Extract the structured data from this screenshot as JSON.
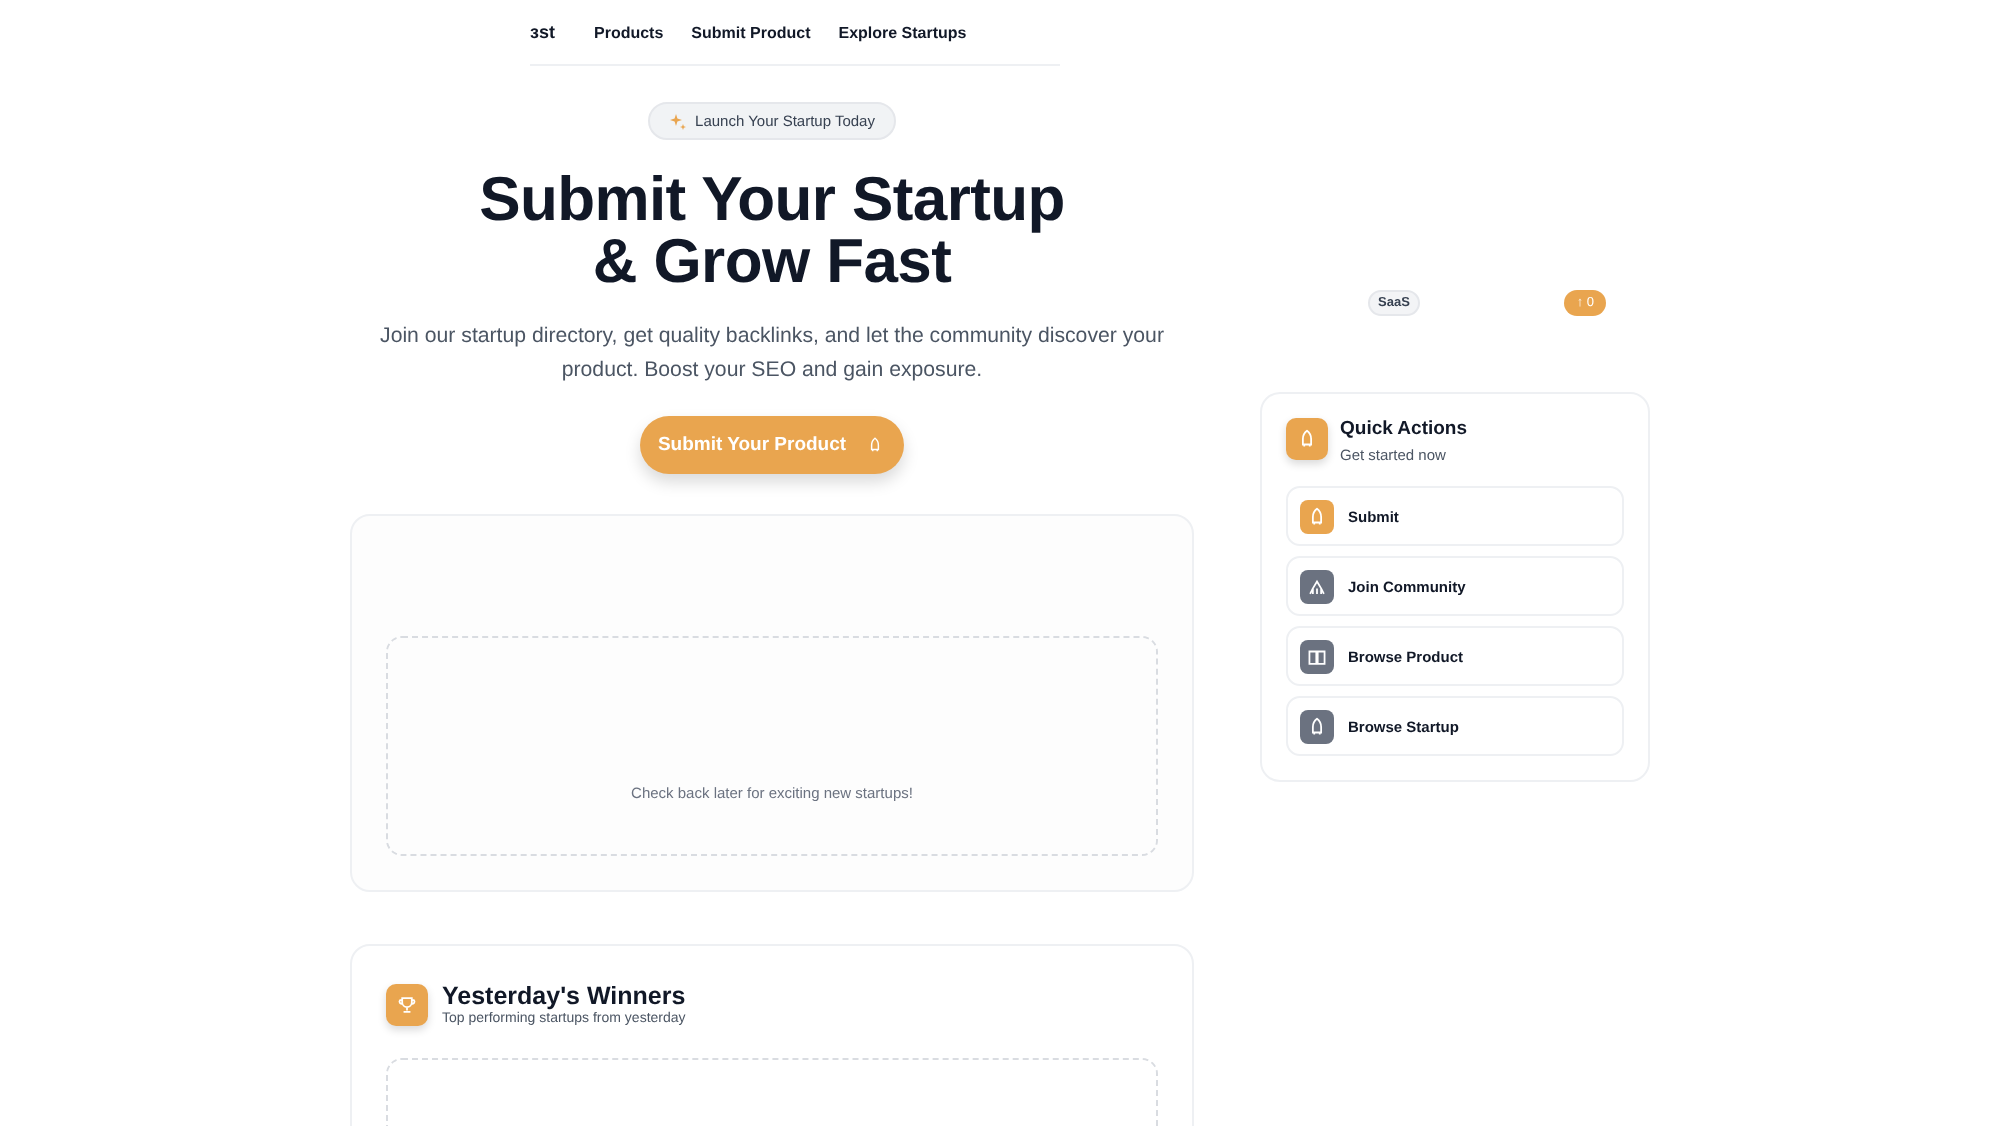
{
  "nav": {
    "logo": "ɜst",
    "links": [
      {
        "label": "Products"
      },
      {
        "label": "Submit Product"
      },
      {
        "label": "Explore Startups"
      }
    ]
  },
  "hero": {
    "badge": "Launch Your Startup Today",
    "title_lines": [
      "Submit Your Startup",
      "& Grow Fast"
    ],
    "subtitle": "Join our startup directory, get quality backlinks, and let the community discover your product. Boost your SEO and gain exposure.",
    "cta": "Submit Your Product"
  },
  "tag": "SaaS",
  "upvote": "↑ 0",
  "launches": {
    "empty_text": "Check back later for exciting new startups!"
  },
  "winners": {
    "title": "Yesterday's Winners",
    "subtitle": "Top performing startups from yesterday"
  },
  "quick_actions": {
    "title": "Quick Actions",
    "subtitle": "Get started now",
    "items": [
      {
        "label": "Submit",
        "kind": "primary"
      },
      {
        "label": "Join Community",
        "kind": "secondary"
      },
      {
        "label": "Browse Product",
        "kind": "secondary"
      },
      {
        "label": "Browse Startup",
        "kind": "secondary"
      }
    ]
  }
}
